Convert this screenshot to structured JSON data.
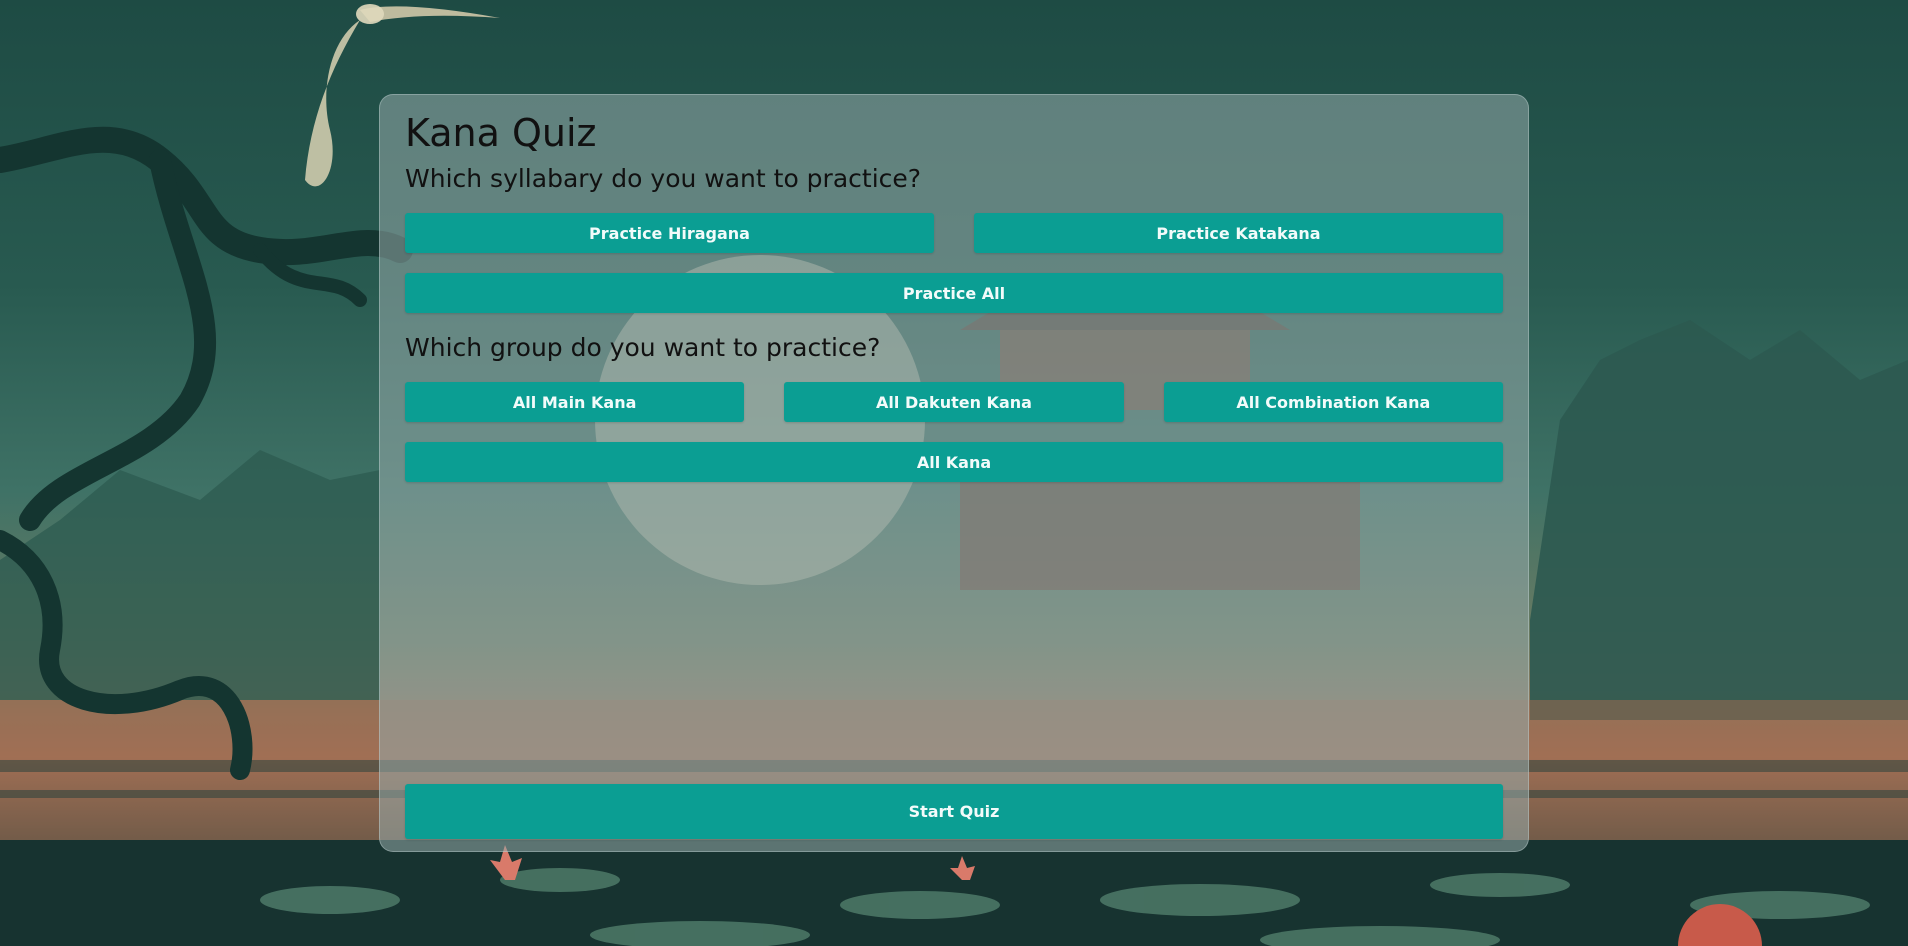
{
  "app": {
    "title": "Kana Quiz"
  },
  "syllabary": {
    "heading": "Which syllabary do you want to practice?",
    "buttons": {
      "hiragana": "Practice Hiragana",
      "katakana": "Practice Katakana",
      "all": "Practice All"
    }
  },
  "group": {
    "heading": "Which group do you want to practice?",
    "buttons": {
      "main": "All Main Kana",
      "dakuten": "All Dakuten Kana",
      "combination": "All Combination Kana",
      "all": "All Kana"
    }
  },
  "start": {
    "label": "Start Quiz"
  },
  "colors": {
    "button": "#0b9e93",
    "button_text": "#f2fbfa",
    "panel": "rgba(150,170,170,0.55)",
    "background_top": "#1e4b44",
    "background_horizon": "#a6765a"
  },
  "background": {
    "icons": [
      "heron-icon",
      "twisted-tree-icon",
      "pagoda-icon",
      "moon-icon",
      "lotus-flower-icon",
      "lily-pad-icon",
      "forest-silhouette-icon"
    ]
  }
}
